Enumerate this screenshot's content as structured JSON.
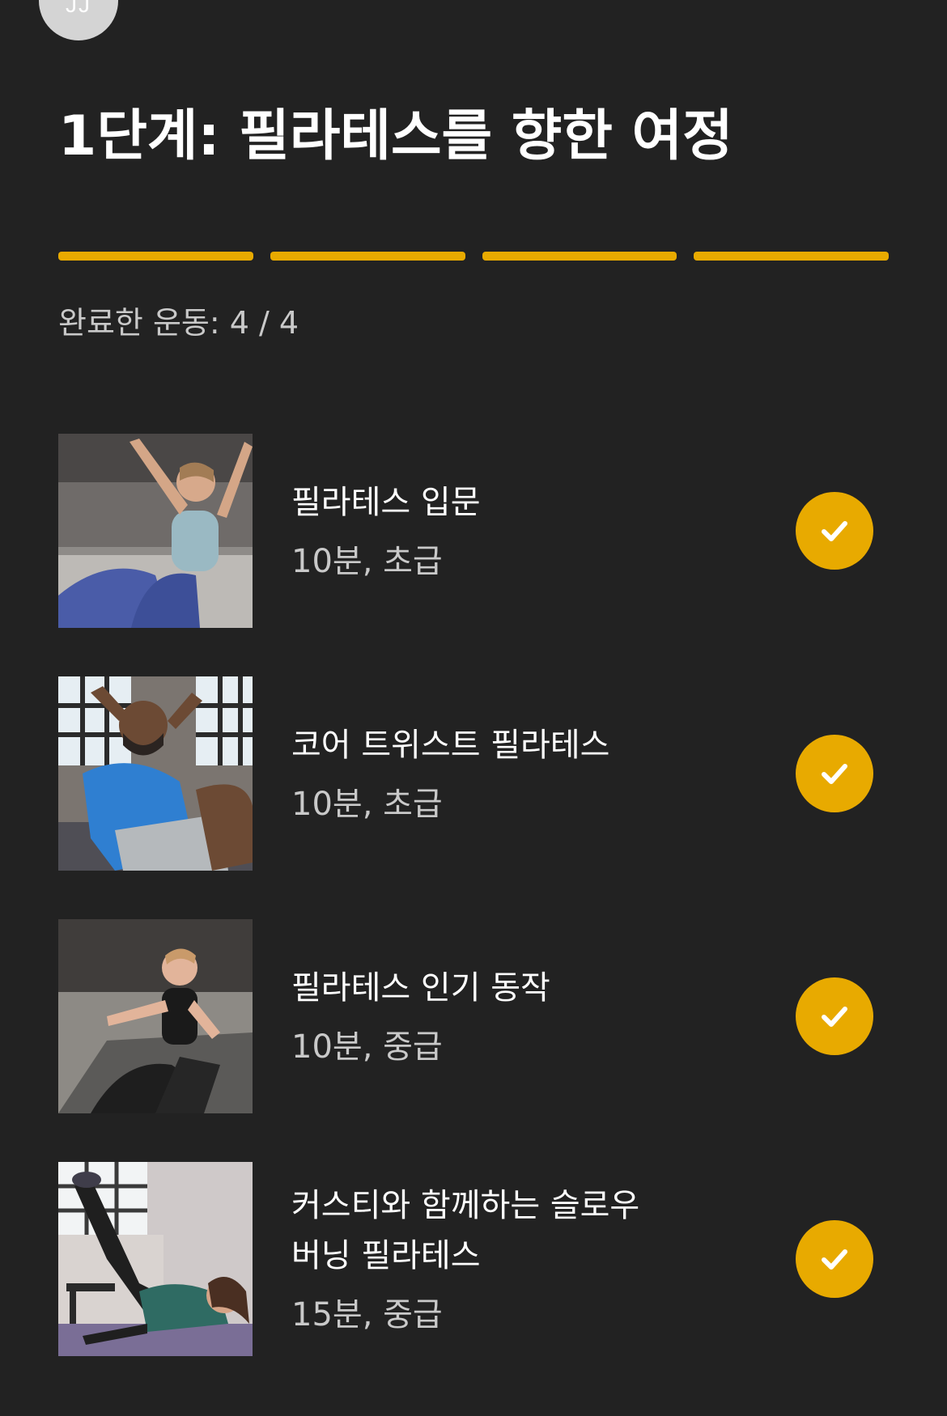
{
  "avatar": {
    "initials": "JJ"
  },
  "page_title": "1단계: 필라테스를 향한 여정",
  "progress": {
    "completed": 4,
    "total": 4,
    "color": "#e8aa00"
  },
  "completed_label": "완료한 운동: 4 / 4",
  "check_icon": "checkmark-icon",
  "workouts": [
    {
      "title_lines": [
        "필라테스 입문"
      ],
      "meta": "10분, 초급",
      "completed": true,
      "image": "woman-seated-arms-raised"
    },
    {
      "title_lines": [
        "코어 트위스트 필라테스"
      ],
      "meta": "10분, 초급",
      "completed": true,
      "image": "man-crunch-hands-behind-head"
    },
    {
      "title_lines": [
        "필라테스 인기 동작"
      ],
      "meta": "10분, 중급",
      "completed": true,
      "image": "woman-seated-on-mat-arms-forward"
    },
    {
      "title_lines": [
        "커스티와 함께하는 슬로우",
        "버닝 필라테스"
      ],
      "meta": "15분, 중급",
      "completed": true,
      "image": "woman-side-leg-lift"
    }
  ]
}
